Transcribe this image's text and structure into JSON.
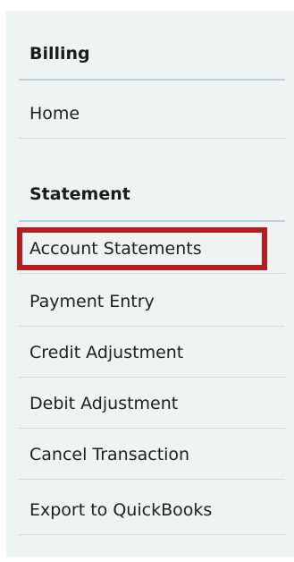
{
  "billing": {
    "heading": "Billing",
    "items": [
      {
        "label": "Home"
      }
    ]
  },
  "statement": {
    "heading": "Statement",
    "items": [
      {
        "label": "Account Statements",
        "highlighted": true
      },
      {
        "label": "Payment Entry"
      },
      {
        "label": "Credit Adjustment"
      },
      {
        "label": "Debit Adjustment"
      },
      {
        "label": "Cancel Transaction"
      },
      {
        "label": "Export to QuickBooks"
      }
    ]
  },
  "colors": {
    "panel_bg": "#eef4f2",
    "divider": "#b9d0dc",
    "highlight_border": "#b81c1c"
  }
}
